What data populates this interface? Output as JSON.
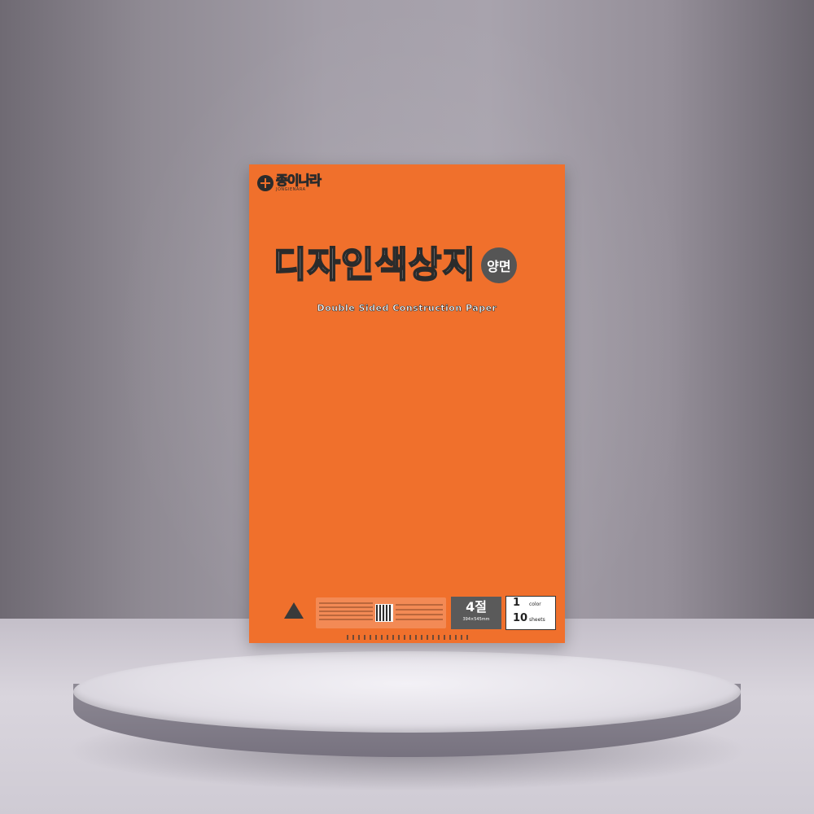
{
  "brand": {
    "name": "종이나라",
    "sub": "JONGIENARA"
  },
  "product": {
    "title": "디자인색상지",
    "badge": "양면",
    "subtitle": "Double Sided Construction Paper"
  },
  "labels": {
    "size_main": "4절",
    "size_sub": "394×545mm",
    "count": [
      {
        "num": "1",
        "unit": "color"
      },
      {
        "num": "10",
        "unit": "sheets"
      }
    ]
  },
  "colors": {
    "pack": "#f0702c",
    "ink": "#2b2b2b"
  }
}
